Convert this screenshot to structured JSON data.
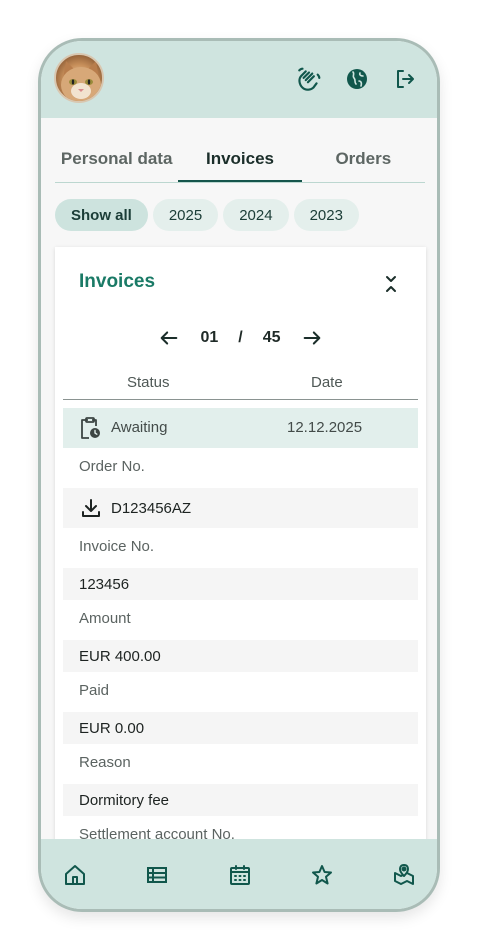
{
  "tabs": [
    {
      "label": "Personal data"
    },
    {
      "label": "Invoices"
    },
    {
      "label": "Orders"
    }
  ],
  "filters": [
    {
      "label": "Show all"
    },
    {
      "label": "2025"
    },
    {
      "label": "2024"
    },
    {
      "label": "2023"
    }
  ],
  "card": {
    "title": "Invoices",
    "pager": {
      "current": "01",
      "separator": "/",
      "total": "45"
    },
    "columns": {
      "status": "Status",
      "date": "Date"
    },
    "status_row": {
      "status": "Awaiting",
      "date": "12.12.2025"
    },
    "fields": {
      "order_no_label": "Order No.",
      "order_no_value": "D123456AZ",
      "invoice_no_label": "Invoice No.",
      "invoice_no_value": "123456",
      "amount_label": "Amount",
      "amount_value": "EUR 400.00",
      "paid_label": "Paid",
      "paid_value": "EUR 0.00",
      "reason_label": "Reason",
      "reason_value": "Dormitory fee",
      "settlement_label": "Settlement account No."
    }
  },
  "icons": {
    "wave": "hand-wave-icon",
    "language": "globe-icon",
    "logout": "logout-icon",
    "home": "home-icon",
    "list": "list-icon",
    "calendar": "calendar-icon",
    "favorites": "star-icon",
    "map": "map-pin-icon"
  },
  "colors": {
    "accent": "#1a7a66",
    "bar_bg": "#cfe4df",
    "icon": "#11574c"
  }
}
